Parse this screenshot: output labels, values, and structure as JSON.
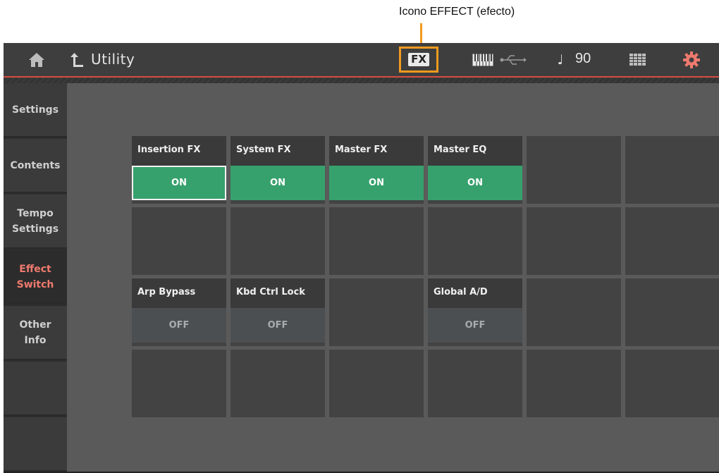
{
  "annotation": {
    "label": "Icono EFFECT (efecto)",
    "highlight_color": "#f29a1f"
  },
  "topbar": {
    "title": "Utility",
    "fx_icon_text": "FX",
    "tempo": "90",
    "accent_line_color": "#d64b3f",
    "icons": [
      "home-icon",
      "back-arrow-icon",
      "fx-icon",
      "keyboard-icon",
      "usb-icon",
      "quarter-note-icon",
      "grid-icon",
      "gear-icon"
    ]
  },
  "sidebar": {
    "tabs": [
      {
        "label": "Settings",
        "active": false
      },
      {
        "label": "Contents",
        "active": false
      },
      {
        "label": "Tempo\nSettings",
        "active": false
      },
      {
        "label": "Effect\nSwitch",
        "active": true
      },
      {
        "label": "Other\nInfo",
        "active": false
      },
      {
        "label": "",
        "active": false
      },
      {
        "label": "",
        "active": false
      }
    ],
    "active_color": "#f07a6e"
  },
  "switches": {
    "insertion_fx": {
      "label": "Insertion FX",
      "value": "ON"
    },
    "system_fx": {
      "label": "System FX",
      "value": "ON"
    },
    "master_fx": {
      "label": "Master FX",
      "value": "ON"
    },
    "master_eq": {
      "label": "Master EQ",
      "value": "ON"
    },
    "arp_bypass": {
      "label": "Arp Bypass",
      "value": "OFF"
    },
    "kbd_ctrl_lock": {
      "label": "Kbd Ctrl Lock",
      "value": "OFF"
    },
    "global_ad": {
      "label": "Global A/D",
      "value": "OFF"
    }
  },
  "colors": {
    "on": "#36a16c",
    "off": "#4c4f52"
  }
}
